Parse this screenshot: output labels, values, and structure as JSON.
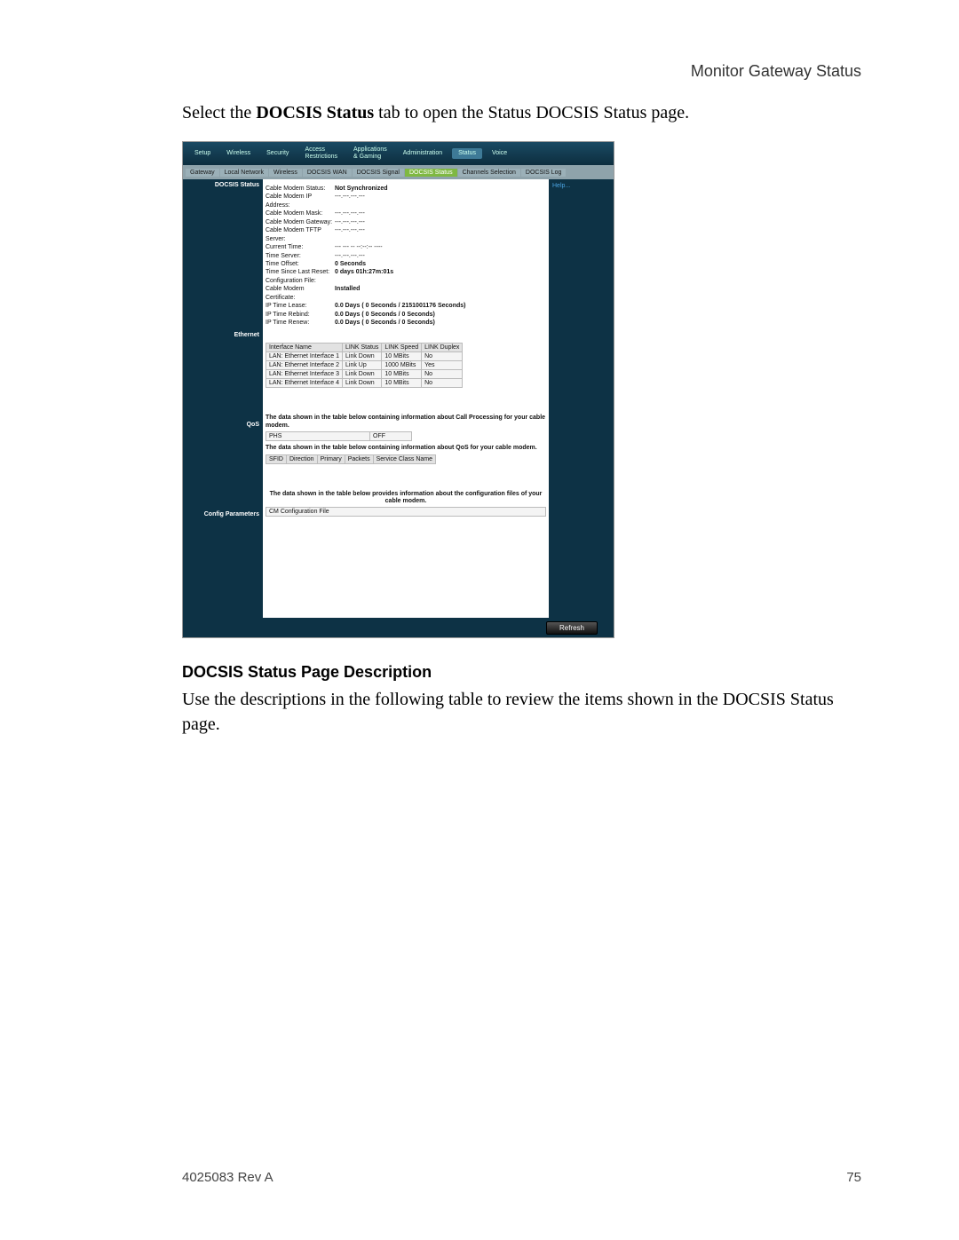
{
  "doc": {
    "header_right": "Monitor Gateway Status",
    "intro_pre": "Select the ",
    "intro_bold": "DOCSIS Status",
    "intro_post": " tab to open the Status DOCSIS Status page.",
    "section_heading": "DOCSIS Status Page Description",
    "section_body": "Use the descriptions in the following table to review the items shown in the DOCSIS Status page.",
    "footer_left": "4025083 Rev A",
    "footer_right": "75"
  },
  "nav": {
    "tabs": {
      "setup": "Setup",
      "wireless": "Wireless",
      "security": "Security",
      "access": "Access\nRestrictions",
      "apps": "Applications\n& Gaming",
      "admin": "Administration",
      "status": "Status",
      "voice": "Voice"
    },
    "subtabs": {
      "gateway": "Gateway",
      "localnet": "Local Network",
      "wireless": "Wireless",
      "docsis_wan": "DOCSIS WAN",
      "docsis_signal": "DOCSIS Signal",
      "docsis_status": "DOCSIS Status",
      "channels": "Channels Selection",
      "docsis_log": "DOCSIS Log"
    }
  },
  "side": {
    "docsis_status": "DOCSIS Status",
    "ethernet": "Ethernet",
    "qos": "QoS",
    "config_params": "Config Parameters"
  },
  "help": {
    "label": "Help..."
  },
  "status_kv": [
    {
      "k": "Cable Modem Status:",
      "v": "Not Synchronized",
      "b": true
    },
    {
      "k": "Cable Modem IP Address:",
      "v": "---.---.---.---"
    },
    {
      "k": "Cable Modem Mask:",
      "v": "---.---.---.---"
    },
    {
      "k": "Cable Modem Gateway:",
      "v": "---.---.---.---"
    },
    {
      "k": "Cable Modem TFTP Server:",
      "v": "---.---.---.---"
    },
    {
      "k": "Current Time:",
      "v": "--- --- -- --:--:-- ----"
    },
    {
      "k": "Time Server:",
      "v": "---.---.---.---"
    },
    {
      "k": "Time Offset:",
      "v": "0 Seconds",
      "b": true
    },
    {
      "k": "Time Since Last Reset:",
      "v": "0 days 01h:27m:01s",
      "b": true
    },
    {
      "k": "Configuration File:",
      "v": ""
    },
    {
      "k": "Cable Modem Certificate:",
      "v": "Installed",
      "b": true
    },
    {
      "k": "IP Time Lease:",
      "v": "0.0 Days ( 0 Seconds / 2151001176 Seconds)",
      "b": true
    },
    {
      "k": "IP Time Rebind:",
      "v": "0.0 Days ( 0 Seconds / 0 Seconds)",
      "b": true
    },
    {
      "k": "IP Time Renew:",
      "v": "0.0 Days ( 0 Seconds / 0 Seconds)",
      "b": true
    }
  ],
  "eth_table": {
    "headers": [
      "Interface Name",
      "LINK Status",
      "LINK Speed",
      "LINK Duplex"
    ],
    "rows": [
      [
        "LAN: Ethernet Interface 1",
        "Link Down",
        "10 MBits",
        "No"
      ],
      [
        "LAN: Ethernet Interface 2",
        "Link Up",
        "1000 MBits",
        "Yes"
      ],
      [
        "LAN: Ethernet Interface 3",
        "Link Down",
        "10 MBits",
        "No"
      ],
      [
        "LAN: Ethernet Interface 4",
        "Link Down",
        "10 MBits",
        "No"
      ]
    ]
  },
  "qos": {
    "note1": "The data shown in the table below containing information about Call Processing for your cable modem.",
    "phs_row": [
      "PHS",
      "OFF"
    ],
    "note2": "The data shown in the table below containing information about QoS for your cable modem.",
    "headers": [
      "SFID",
      "Direction",
      "Primary",
      "Packets",
      "Service Class Name"
    ]
  },
  "config": {
    "note": "The data shown in the table below provides information about the configuration files of your cable modem.",
    "row": "CM Configuration File"
  },
  "refresh_label": "Refresh"
}
